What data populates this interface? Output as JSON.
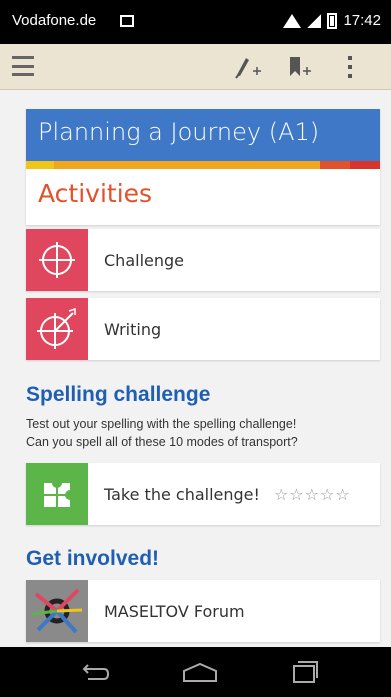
{
  "status_bar": {
    "carrier": "Vodafone.de",
    "time": "17:42"
  },
  "header": {
    "title": "Planning a Journey (A1)",
    "subtitle": "Activities",
    "title_color": "#3e78c6",
    "subtitle_color": "#e2512a",
    "stripe_colors": [
      "#f0c419",
      "#e8a317",
      "#e2512a",
      "#d9342b"
    ]
  },
  "activities": [
    {
      "label": "Challenge",
      "icon": "crosshair-icon",
      "color": "#e0475f"
    },
    {
      "label": "Writing",
      "icon": "dart-target-icon",
      "color": "#e0475f"
    }
  ],
  "spelling": {
    "title": "Spelling challenge",
    "desc_line1": "Test out your spelling with the spelling challenge!",
    "desc_line2": "Can you spell all of these 10 modes of transport?",
    "item_label": "Take the challenge!",
    "item_icon": "puzzle-icon",
    "item_color": "#5bb548",
    "rating": 0,
    "rating_max": 5
  },
  "involved": {
    "title": "Get involved!",
    "item_label": "MASELTOV Forum",
    "item_icon": "forum-logo-icon"
  },
  "colors": {
    "action_bar": "#ebe4d2",
    "section_title": "#1f5fb3"
  }
}
